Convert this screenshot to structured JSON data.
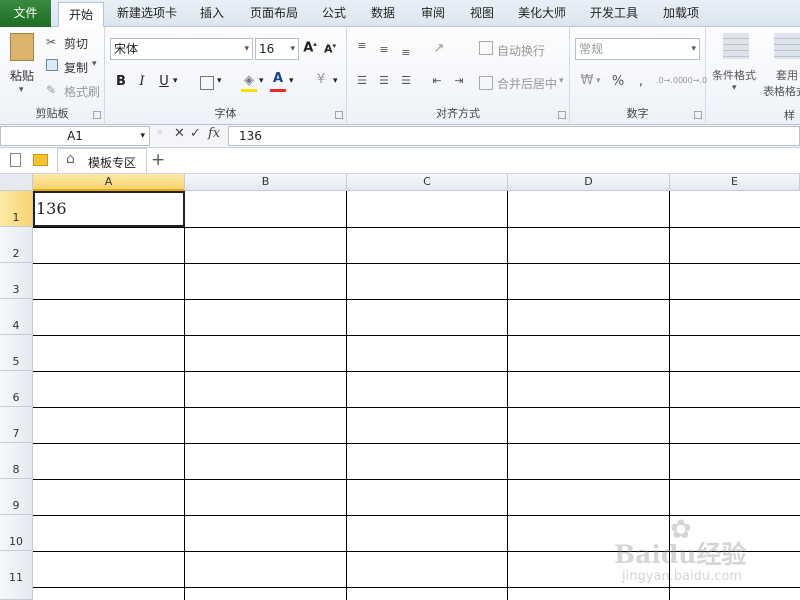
{
  "ribbon_tabs": [
    "文件",
    "开始",
    "新建选项卡",
    "插入",
    "页面布局",
    "公式",
    "数据",
    "审阅",
    "视图",
    "美化大师",
    "开发工具",
    "加载项"
  ],
  "clipboard": {
    "paste": "粘贴",
    "cut": "剪切",
    "copy": "复制",
    "format_painter": "格式刷",
    "label": "剪贴板"
  },
  "font": {
    "name": "宋体",
    "size": "16",
    "bold": "B",
    "italic": "I",
    "underline": "U",
    "color_letter": "A",
    "label": "字体"
  },
  "alignment": {
    "wrap": "自动换行",
    "merge": "合并后居中",
    "label": "对齐方式"
  },
  "number": {
    "format": "常规",
    "percent": "%",
    "comma": ",",
    "inc_decimal": ".0→.00",
    "dec_decimal": ".00→.0",
    "label": "数字"
  },
  "styles": {
    "conditional": "条件格式",
    "table_fmt_a": "套用",
    "table_fmt_b": "表格格式",
    "label": "样式"
  },
  "formula_bar": {
    "name_box": "A1",
    "cancel": "✕",
    "confirm": "✓",
    "fx": "fx",
    "value": "136"
  },
  "sheet_tabs": {
    "template": "模板专区",
    "add": "+"
  },
  "columns": [
    "A",
    "B",
    "C",
    "D",
    "E"
  ],
  "rows": [
    "1",
    "2",
    "3",
    "4",
    "5",
    "6",
    "7",
    "8",
    "9",
    "10",
    "11"
  ],
  "cells": {
    "A1": "136"
  },
  "watermark": {
    "brand": "Baidu经验",
    "url": "jingyan.baidu.com"
  },
  "colors": {
    "file_tab": "#2a7a30",
    "selection_header": "#f7d46e",
    "font_color_bar": "#e8282b"
  }
}
